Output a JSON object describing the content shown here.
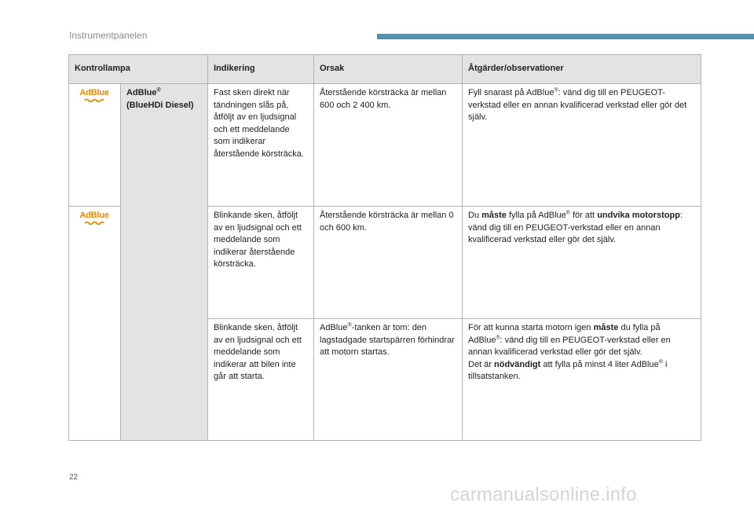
{
  "header": {
    "title": "Instrumentpanelen",
    "accent_color": "#4f93b1"
  },
  "table": {
    "columns": [
      "Kontrollampa",
      "Indikering",
      "Orsak",
      "Åtgärder/observationer"
    ],
    "lamp_name": "AdBlue",
    "lamp_name_suffix": "(BlueHDi Diesel)",
    "icon": {
      "name": "adblue-warning-icon",
      "text": "AdBlue",
      "color": "#e68a00"
    },
    "rows": [
      {
        "indication": "Fast sken direkt när tändningen slås på, åtföljt av en ljudsignal och ett meddelande som indikerar återstående körsträcka.",
        "cause": "Återstående körsträcka är mellan 600 och 2 400 km.",
        "action_parts": [
          "Fyll snarast på AdBlue",
          "®",
          ": vänd dig till en PEUGEOT-verkstad eller en annan kvalificerad verkstad eller gör det själv."
        ]
      },
      {
        "indication": "Blinkande sken, åtföljt av en ljudsignal och ett meddelande som indikerar återstående körsträcka.",
        "cause": "Återstående körsträcka är mellan 0 och 600 km.",
        "action_parts": [
          "Du ",
          "måste",
          " fylla på AdBlue",
          "®",
          " för att ",
          "undvika motorstopp",
          ": vänd dig till en PEUGEOT-verkstad eller en annan kvalificerad verkstad eller gör det själv."
        ]
      },
      {
        "indication": "Blinkande sken, åtföljt av en ljudsignal och ett meddelande som indikerar att bilen inte går att starta.",
        "cause_parts": [
          "AdBlue",
          "®",
          "-tanken är tom: den lagstadgade startspärren förhindrar att motorn startas."
        ],
        "action_parts": [
          "För att kunna starta motorn igen ",
          "måste",
          " du fylla på AdBlue",
          "®",
          ": vänd dig till en PEUGEOT-verkstad eller en annan kvalificerad verkstad eller gör det själv.",
          "Det är ",
          "nödvändigt",
          " att fylla på minst 4 liter AdBlue",
          "®",
          " i tillsatstanken."
        ]
      }
    ]
  },
  "footer": {
    "page_number": "22",
    "watermark": "carmanualsonline.info"
  }
}
